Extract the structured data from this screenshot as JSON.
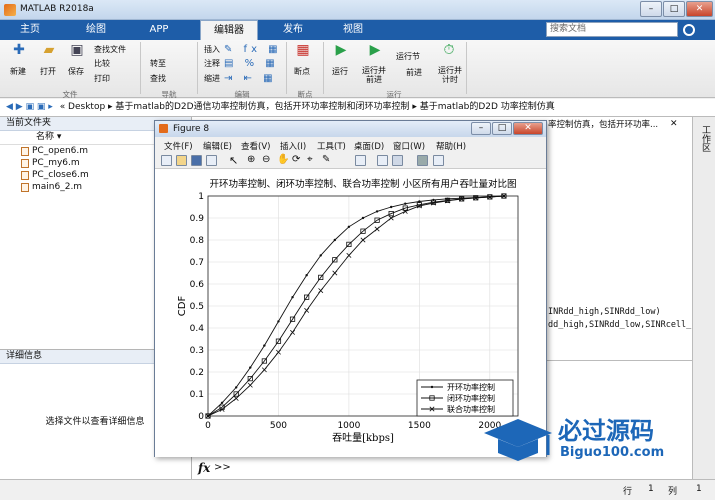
{
  "window": {
    "title": "MATLAB R2018a",
    "min": "–",
    "max": "□",
    "close": "✕"
  },
  "tabs": [
    "主页",
    "绘图",
    "APP",
    "编辑器",
    "发布",
    "视图"
  ],
  "search": {
    "placeholder": "搜索文档"
  },
  "ribbon": {
    "file": {
      "new": "新建",
      "open": "打开",
      "save": "保存",
      "find_files": "查找文件",
      "compare": "比较",
      "print": "打印",
      "group": "文件"
    },
    "nav": {
      "goto": "转至",
      "find": "查找",
      "group": "导航"
    },
    "edit": {
      "insert": "插入",
      "comment": "注释",
      "indent": "缩进",
      "group": "编辑"
    },
    "bp": {
      "breakpoints": "断点",
      "group": "断点"
    },
    "run": {
      "run": "运行",
      "run_advance": "运行并\n前进",
      "run_section": "运行节",
      "advance": "前进",
      "run_time": "运行并\n计时",
      "group": "运行"
    }
  },
  "address": {
    "path": "« Desktop ▸ 基于matlab的D2D通信功率控制仿真，包括开环功率控制和闭环功率控制 ▸ 基于matlab的D2D 功率控制仿真"
  },
  "current_folder": {
    "title": "当前文件夹",
    "col_name": "名称 ▾",
    "files": [
      "PC_open6.m",
      "PC_my6.m",
      "PC_close6.m",
      "main6_2.m"
    ]
  },
  "details": {
    "title": "详细信息",
    "empty": "选择文件以查看详细信息"
  },
  "bg": {
    "crumb": "率控制仿真，包括开环功率...",
    "code1": "INRdd_high,SINRdd_low)",
    "code2": "dd_high,SINRdd_low,SINRcell_"
  },
  "cmd": {
    "fx": "fx",
    "prompt": ">>"
  },
  "status": {
    "line_label": "行",
    "line": "1",
    "col_label": "列",
    "col": "1"
  },
  "sidebar": {
    "label": "工作区"
  },
  "figure": {
    "title": "Figure 8",
    "menu": [
      "文件(F)",
      "编辑(E)",
      "查看(V)",
      "插入(I)",
      "工具(T)",
      "桌面(D)",
      "窗口(W)",
      "帮助(H)"
    ]
  },
  "watermark": {
    "text": "必过源码",
    "url": "Biguo100.com"
  },
  "chart_data": {
    "type": "line",
    "title": "开环功率控制、闭环功率控制、联合功率控制 小区所有用户吞吐量对比图",
    "xlabel": "吞吐量[kbps]",
    "ylabel": "CDF",
    "xlim": [
      0,
      2200
    ],
    "ylim": [
      0,
      1
    ],
    "xticks": [
      0,
      500,
      1000,
      1500,
      2000
    ],
    "yticks": [
      0,
      0.1,
      0.2,
      0.3,
      0.4,
      0.5,
      0.6,
      0.7,
      0.8,
      0.9,
      1
    ],
    "grid": true,
    "legend": "bottom-right",
    "series": [
      {
        "name": "开环功率控制",
        "marker": "dot",
        "x": [
          0,
          100,
          200,
          300,
          400,
          500,
          600,
          700,
          800,
          900,
          1000,
          1100,
          1200,
          1300,
          1400,
          1500,
          1600,
          1700,
          1800,
          1900,
          2000,
          2100
        ],
        "y": [
          0,
          0.06,
          0.13,
          0.22,
          0.32,
          0.43,
          0.54,
          0.64,
          0.73,
          0.8,
          0.86,
          0.9,
          0.93,
          0.95,
          0.965,
          0.975,
          0.982,
          0.987,
          0.99,
          0.993,
          0.996,
          1
        ]
      },
      {
        "name": "闭环功率控制",
        "marker": "square",
        "x": [
          0,
          100,
          200,
          300,
          400,
          500,
          600,
          700,
          800,
          900,
          1000,
          1100,
          1200,
          1300,
          1400,
          1500,
          1600,
          1700,
          1800,
          1900,
          2000,
          2100
        ],
        "y": [
          0,
          0.04,
          0.1,
          0.17,
          0.25,
          0.34,
          0.44,
          0.54,
          0.63,
          0.71,
          0.78,
          0.84,
          0.89,
          0.92,
          0.945,
          0.96,
          0.972,
          0.98,
          0.987,
          0.992,
          0.996,
          1
        ]
      },
      {
        "name": "联合功率控制",
        "marker": "x",
        "x": [
          0,
          100,
          200,
          300,
          400,
          500,
          600,
          700,
          800,
          900,
          1000,
          1100,
          1200,
          1300,
          1400,
          1500,
          1600,
          1700,
          1800,
          1900,
          2000,
          2100
        ],
        "y": [
          0,
          0.03,
          0.08,
          0.14,
          0.21,
          0.29,
          0.38,
          0.48,
          0.57,
          0.65,
          0.73,
          0.8,
          0.85,
          0.9,
          0.93,
          0.955,
          0.968,
          0.978,
          0.986,
          0.991,
          0.995,
          1
        ]
      }
    ]
  }
}
